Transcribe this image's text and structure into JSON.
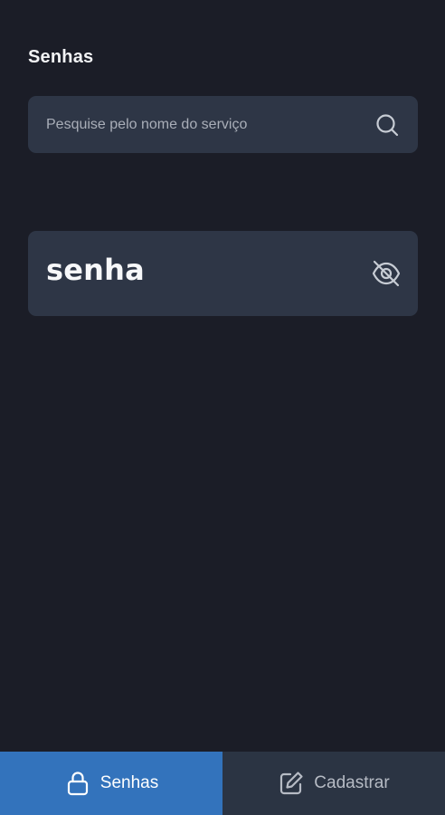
{
  "header": {
    "title": "Senhas"
  },
  "search": {
    "placeholder": "Pesquise pelo nome do serviço",
    "icon": "search-icon"
  },
  "password_list": [
    {
      "value": "senha",
      "visibility_icon": "eye-off-icon"
    }
  ],
  "tabs": [
    {
      "label": "Senhas",
      "icon": "lock-icon",
      "active": true
    },
    {
      "label": "Cadastrar",
      "icon": "edit-icon",
      "active": false
    }
  ],
  "colors": {
    "background": "#1b1d27",
    "card": "#2e3646",
    "active_tab": "#3373bc",
    "inactive_tab": "#2b3443"
  }
}
